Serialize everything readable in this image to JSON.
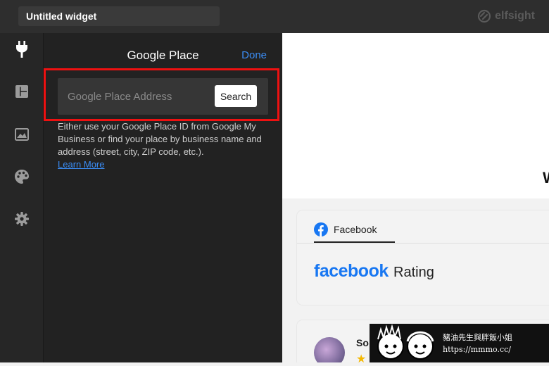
{
  "topbar": {
    "widget_title": "Untitled widget",
    "brand": "elfsight"
  },
  "rail": {
    "items": [
      {
        "icon": "plug-icon",
        "active": true
      },
      {
        "icon": "layout-icon",
        "active": false
      },
      {
        "icon": "image-icon",
        "active": false
      },
      {
        "icon": "palette-icon",
        "active": false
      },
      {
        "icon": "gear-icon",
        "active": false
      }
    ]
  },
  "panel": {
    "title": "Google Place",
    "done_label": "Done",
    "search_placeholder": "Google Place Address",
    "search_button": "Search",
    "help_text": "Either use your Google Place ID from Google My Business or find your place by business name and address (street, city, ZIP code, etc.).",
    "learn_more": "Learn More",
    "highlight_color": "#e11111"
  },
  "preview": {
    "clipped_heading_letter": "W",
    "tab_label": "Facebook",
    "brand_word": "facebook",
    "rating_word": "Rating",
    "reviewer_partial": "So",
    "accent": "#1877f2"
  },
  "watermark": {
    "line1": "豬油先生與胖飯小姐",
    "line2": "https://mmmo.cc/"
  }
}
